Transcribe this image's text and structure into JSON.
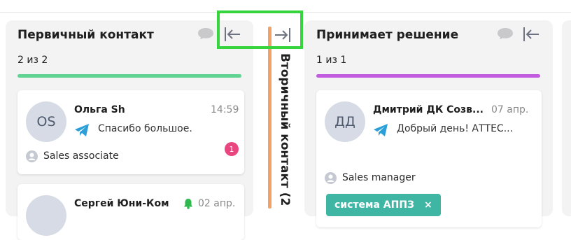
{
  "columns": [
    {
      "title": "Первичный контакт",
      "count": "2 из 2",
      "bar_color": "#5ed490",
      "cards": [
        {
          "initials": "ОS",
          "name": "Ольга Sh",
          "time": "14:59",
          "message": "Спасибо большое.",
          "unread": "1",
          "role": "Sales associate"
        },
        {
          "initials": "",
          "name": "Сергей Юни-Ком",
          "time": "02 апр."
        }
      ]
    },
    {
      "title": "Вторичный контакт (2",
      "bar_color": "#f0a269",
      "collapsed": true
    },
    {
      "title": "Принимает решение",
      "count": "1 из 1",
      "bar_color": "#c35be0",
      "cards": [
        {
          "initials": "ДД",
          "name": "Дмитрий ДК Созв...",
          "time": "07 апр.",
          "message": "Добрый день! АТТЕС...",
          "role": "Sales manager",
          "tag": "система АППЗ",
          "tag_remove": "×"
        }
      ]
    }
  ],
  "colors": {
    "highlight": "#36d43d",
    "telegram": "#2a9fd8",
    "tag": "#3fb5a3",
    "badge": "#e9457e"
  },
  "icons": [
    "chat-bubble-icon",
    "collapse-left-icon",
    "expand-right-icon",
    "telegram-icon",
    "person-icon",
    "bell-icon",
    "close-icon"
  ]
}
